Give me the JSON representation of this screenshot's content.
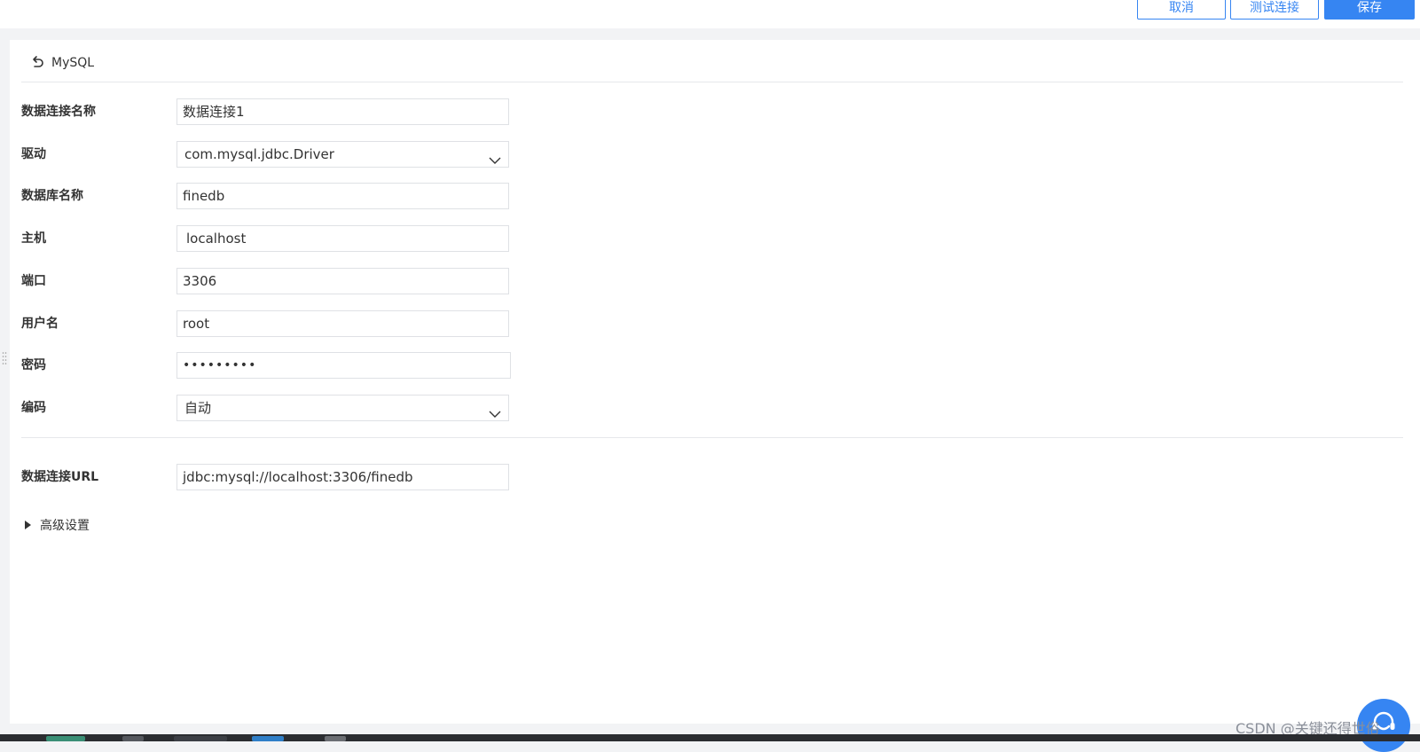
{
  "toolbar": {
    "cancel_label": "取消",
    "test_label": "测试连接",
    "save_label": "保存"
  },
  "header": {
    "back_label": "MySQL"
  },
  "form": {
    "connection_name": {
      "label": "数据连接名称",
      "value": "数据连接1"
    },
    "driver": {
      "label": "驱动",
      "value": "com.mysql.jdbc.Driver"
    },
    "database_name": {
      "label": "数据库名称",
      "value": "finedb"
    },
    "host": {
      "label": "主机",
      "value": "localhost"
    },
    "port": {
      "label": "端口",
      "value": "3306"
    },
    "username": {
      "label": "用户名",
      "value": "root"
    },
    "password": {
      "label": "密码",
      "value": "•••••••••"
    },
    "encoding": {
      "label": "编码",
      "value": "自动"
    },
    "url": {
      "label": "数据连接URL",
      "value": "jdbc:mysql://localhost:3306/finedb"
    }
  },
  "advanced": {
    "label": "高级设置"
  },
  "watermark": "CSDN @关键还得世俗",
  "colors": {
    "accent": "#3685f2",
    "border": "#dfe1e5",
    "background": "#f2f3f5"
  }
}
